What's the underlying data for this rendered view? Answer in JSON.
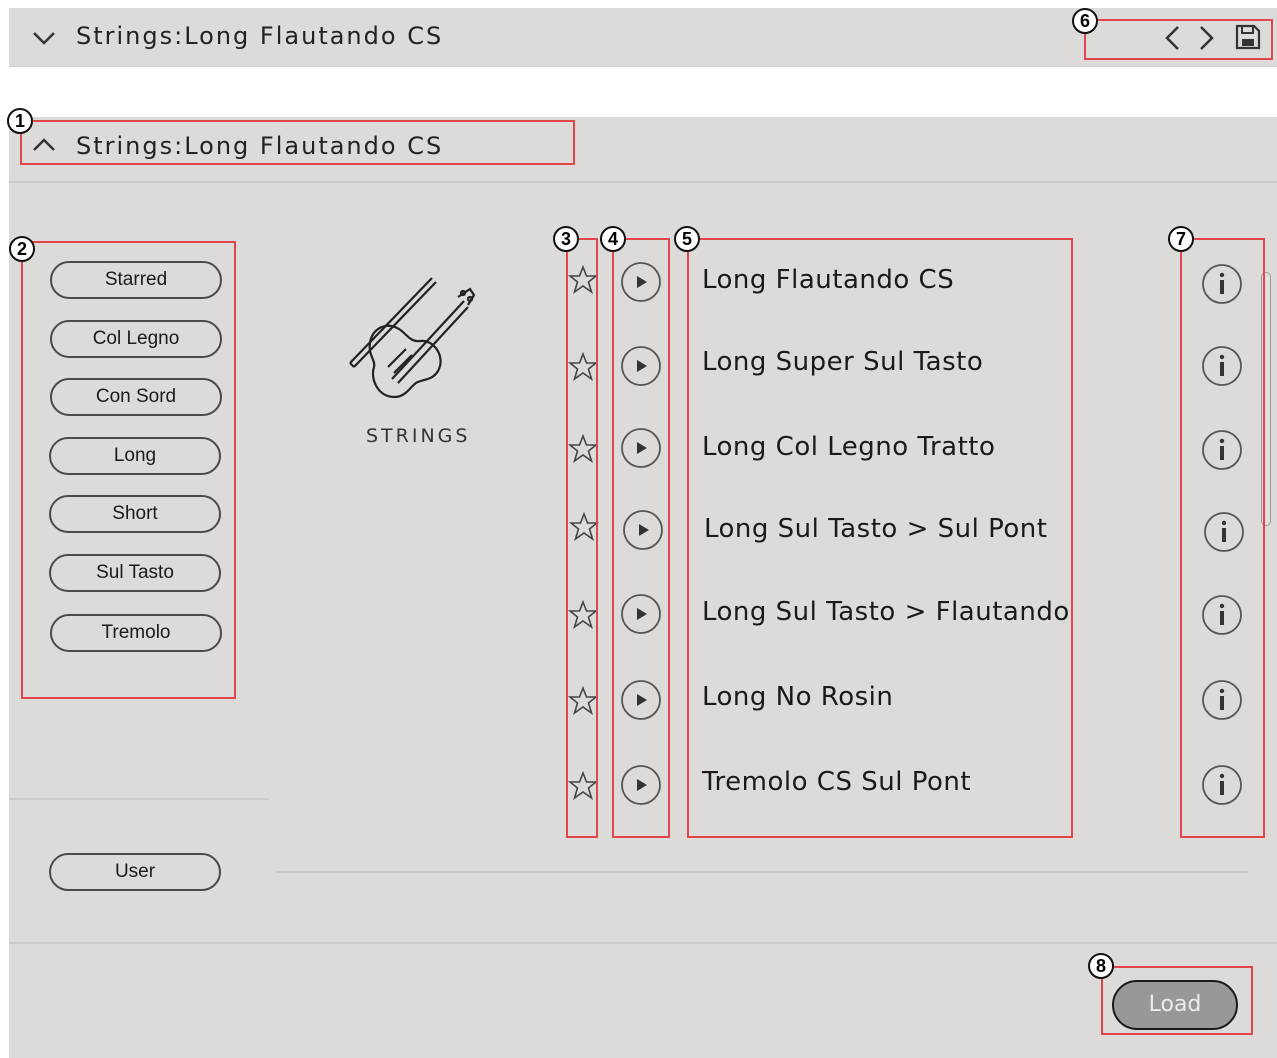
{
  "header": {
    "title": "Strings:Long Flautando CS",
    "nav_prev_icon": "chevron-left-icon",
    "nav_next_icon": "chevron-right-icon",
    "save_icon": "floppy-disk-icon"
  },
  "section": {
    "title": "Strings:Long Flautando CS"
  },
  "category": {
    "label": "STRINGS",
    "icon": "violin-icon"
  },
  "tags": [
    "Starred",
    "Col Legno",
    "Con Sord",
    "Long",
    "Short",
    "Sul Tasto",
    "Tremolo"
  ],
  "user_tag": "User",
  "presets": [
    "Long Flautando CS",
    "Long Super Sul Tasto",
    "Long Col Legno Tratto",
    "Long Sul Tasto > Sul Pont",
    "Long Sul Tasto > Flautando",
    "Long No Rosin",
    "Tremolo CS Sul Pont"
  ],
  "load_button": "Load",
  "callouts": [
    "1",
    "2",
    "3",
    "4",
    "5",
    "6",
    "7",
    "8"
  ],
  "colors": {
    "highlight": "#e0464b",
    "panel": "#dcdbda",
    "load_button": "#9a9897"
  }
}
